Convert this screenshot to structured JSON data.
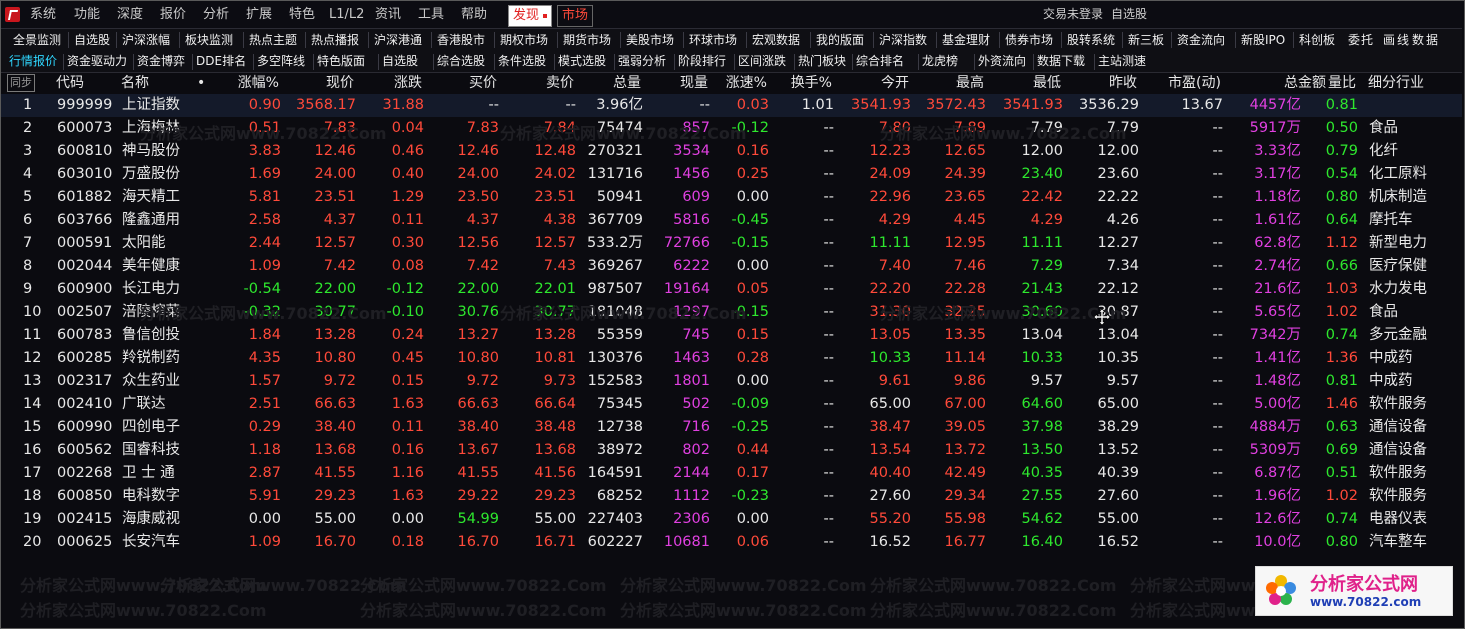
{
  "titlebar": {
    "menu": [
      "系统",
      "功能",
      "深度",
      "报价",
      "分析",
      "扩展",
      "特色",
      "L1/L2",
      "资讯",
      "工具",
      "帮助"
    ],
    "discover_tab": "发现",
    "market_tab": "市场",
    "status_login": "交易未登录",
    "status_watch": "自选股"
  },
  "nav_row1": [
    "全景监测",
    "自选股",
    "沪深涨幅",
    "板块监测",
    "热点主题",
    "热点播报",
    "沪深港通",
    "香港股市",
    "期权市场",
    "期货市场",
    "美股市场",
    "环球市场",
    "宏观数据",
    "我的版面",
    "沪深指数",
    "基金理财",
    "债券市场",
    "股转系统",
    "新三板",
    "资金流向",
    "新股IPO",
    "科创板",
    "委",
    "托",
    "画",
    "线",
    "数",
    "据"
  ],
  "nav_row2": [
    "行情报价",
    "资金驱动力",
    "资金博弈",
    "DDE排名",
    "多空阵线",
    "特色版面",
    "自选股",
    "综合选股",
    "条件选股",
    "模式选股",
    "强弱分析",
    "阶段排行",
    "区间涨跌",
    "热门板块",
    "综合排名",
    "龙虎榜",
    "外资流向",
    "数据下载",
    "主站测速"
  ],
  "table": {
    "sync_label": "同步",
    "headers": [
      "代码",
      "名称",
      "•",
      "涨幅%",
      "现价",
      "涨跌",
      "买价",
      "卖价",
      "总量",
      "现量",
      "涨速%",
      "换手%",
      "今开",
      "最高",
      "最低",
      "昨收",
      "市盈(动)",
      "总金额",
      "量比",
      "细分行业"
    ],
    "rows": [
      {
        "idx": "1",
        "code": "999999",
        "name": "上证指数",
        "chg_pct": "0.90",
        "price": "3568.17",
        "chg": "31.88",
        "bid": "--",
        "ask": "--",
        "vol": "3.96亿",
        "cur_vol": "--",
        "speed": "0.03",
        "turnover": "1.01",
        "open": "3541.93",
        "high": "3572.43",
        "low": "3541.93",
        "prev": "3536.29",
        "pe": "13.67",
        "amount": "4457亿",
        "ratio": "0.81",
        "industry": ""
      },
      {
        "idx": "2",
        "code": "600073",
        "name": "上海梅林",
        "chg_pct": "0.51",
        "price": "7.83",
        "chg": "0.04",
        "bid": "7.83",
        "ask": "7.84",
        "vol": "75474",
        "cur_vol": "857",
        "speed": "-0.12",
        "turnover": "--",
        "open": "7.80",
        "high": "7.89",
        "low": "7.79",
        "prev": "7.79",
        "pe": "--",
        "amount": "5917万",
        "ratio": "0.50",
        "industry": "食品"
      },
      {
        "idx": "3",
        "code": "600810",
        "name": "神马股份",
        "chg_pct": "3.83",
        "price": "12.46",
        "chg": "0.46",
        "bid": "12.46",
        "ask": "12.48",
        "vol": "270321",
        "cur_vol": "3534",
        "speed": "0.16",
        "turnover": "--",
        "open": "12.23",
        "high": "12.65",
        "low": "12.00",
        "prev": "12.00",
        "pe": "--",
        "amount": "3.33亿",
        "ratio": "0.79",
        "industry": "化纤"
      },
      {
        "idx": "4",
        "code": "603010",
        "name": "万盛股份",
        "chg_pct": "1.69",
        "price": "24.00",
        "chg": "0.40",
        "bid": "24.00",
        "ask": "24.02",
        "vol": "131716",
        "cur_vol": "1456",
        "speed": "0.25",
        "turnover": "--",
        "open": "24.09",
        "high": "24.39",
        "low": "23.40",
        "prev": "23.60",
        "pe": "--",
        "amount": "3.17亿",
        "ratio": "0.54",
        "industry": "化工原料"
      },
      {
        "idx": "5",
        "code": "601882",
        "name": "海天精工",
        "chg_pct": "5.81",
        "price": "23.51",
        "chg": "1.29",
        "bid": "23.50",
        "ask": "23.51",
        "vol": "50941",
        "cur_vol": "609",
        "speed": "0.00",
        "turnover": "--",
        "open": "22.96",
        "high": "23.65",
        "low": "22.42",
        "prev": "22.22",
        "pe": "--",
        "amount": "1.18亿",
        "ratio": "0.80",
        "industry": "机床制造"
      },
      {
        "idx": "6",
        "code": "603766",
        "name": "隆鑫通用",
        "chg_pct": "2.58",
        "price": "4.37",
        "chg": "0.11",
        "bid": "4.37",
        "ask": "4.38",
        "vol": "367709",
        "cur_vol": "5816",
        "speed": "-0.45",
        "turnover": "--",
        "open": "4.29",
        "high": "4.45",
        "low": "4.29",
        "prev": "4.26",
        "pe": "--",
        "amount": "1.61亿",
        "ratio": "0.64",
        "industry": "摩托车"
      },
      {
        "idx": "7",
        "code": "000591",
        "name": "太阳能",
        "chg_pct": "2.44",
        "price": "12.57",
        "chg": "0.30",
        "bid": "12.56",
        "ask": "12.57",
        "vol": "533.2万",
        "cur_vol": "72766",
        "speed": "-0.15",
        "turnover": "--",
        "open": "11.11",
        "high": "12.95",
        "low": "11.11",
        "prev": "12.27",
        "pe": "--",
        "amount": "62.8亿",
        "ratio": "1.12",
        "industry": "新型电力"
      },
      {
        "idx": "8",
        "code": "002044",
        "name": "美年健康",
        "chg_pct": "1.09",
        "price": "7.42",
        "chg": "0.08",
        "bid": "7.42",
        "ask": "7.43",
        "vol": "369267",
        "cur_vol": "6222",
        "speed": "0.00",
        "turnover": "--",
        "open": "7.40",
        "high": "7.46",
        "low": "7.29",
        "prev": "7.34",
        "pe": "--",
        "amount": "2.74亿",
        "ratio": "0.66",
        "industry": "医疗保健"
      },
      {
        "idx": "9",
        "code": "600900",
        "name": "长江电力",
        "chg_pct": "-0.54",
        "price": "22.00",
        "chg": "-0.12",
        "bid": "22.00",
        "ask": "22.01",
        "vol": "987507",
        "cur_vol": "19164",
        "speed": "0.05",
        "turnover": "--",
        "open": "22.20",
        "high": "22.28",
        "low": "21.43",
        "prev": "22.12",
        "pe": "--",
        "amount": "21.6亿",
        "ratio": "1.03",
        "industry": "水力发电"
      },
      {
        "idx": "10",
        "code": "002507",
        "name": "涪陵榨菜",
        "chg_pct": "-0.32",
        "price": "30.77",
        "chg": "-0.10",
        "bid": "30.76",
        "ask": "30.77",
        "vol": "181048",
        "cur_vol": "1297",
        "speed": "-0.15",
        "turnover": "--",
        "open": "31.30",
        "high": "32.25",
        "low": "30.60",
        "prev": "30.87",
        "pe": "--",
        "amount": "5.65亿",
        "ratio": "1.02",
        "industry": "食品"
      },
      {
        "idx": "11",
        "code": "600783",
        "name": "鲁信创投",
        "chg_pct": "1.84",
        "price": "13.28",
        "chg": "0.24",
        "bid": "13.27",
        "ask": "13.28",
        "vol": "55359",
        "cur_vol": "745",
        "speed": "0.15",
        "turnover": "--",
        "open": "13.05",
        "high": "13.35",
        "low": "13.04",
        "prev": "13.04",
        "pe": "--",
        "amount": "7342万",
        "ratio": "0.74",
        "industry": "多元金融"
      },
      {
        "idx": "12",
        "code": "600285",
        "name": "羚锐制药",
        "chg_pct": "4.35",
        "price": "10.80",
        "chg": "0.45",
        "bid": "10.80",
        "ask": "10.81",
        "vol": "130376",
        "cur_vol": "1463",
        "speed": "0.28",
        "turnover": "--",
        "open": "10.33",
        "high": "11.14",
        "low": "10.33",
        "prev": "10.35",
        "pe": "--",
        "amount": "1.41亿",
        "ratio": "1.36",
        "industry": "中成药"
      },
      {
        "idx": "13",
        "code": "002317",
        "name": "众生药业",
        "chg_pct": "1.57",
        "price": "9.72",
        "chg": "0.15",
        "bid": "9.72",
        "ask": "9.73",
        "vol": "152583",
        "cur_vol": "1801",
        "speed": "0.00",
        "turnover": "--",
        "open": "9.61",
        "high": "9.86",
        "low": "9.57",
        "prev": "9.57",
        "pe": "--",
        "amount": "1.48亿",
        "ratio": "0.81",
        "industry": "中成药"
      },
      {
        "idx": "14",
        "code": "002410",
        "name": "广联达",
        "chg_pct": "2.51",
        "price": "66.63",
        "chg": "1.63",
        "bid": "66.63",
        "ask": "66.64",
        "vol": "75345",
        "cur_vol": "502",
        "speed": "-0.09",
        "turnover": "--",
        "open": "65.00",
        "high": "67.00",
        "low": "64.60",
        "prev": "65.00",
        "pe": "--",
        "amount": "5.00亿",
        "ratio": "1.46",
        "industry": "软件服务"
      },
      {
        "idx": "15",
        "code": "600990",
        "name": "四创电子",
        "chg_pct": "0.29",
        "price": "38.40",
        "chg": "0.11",
        "bid": "38.40",
        "ask": "38.48",
        "vol": "12738",
        "cur_vol": "716",
        "speed": "-0.25",
        "turnover": "--",
        "open": "38.47",
        "high": "39.05",
        "low": "37.98",
        "prev": "38.29",
        "pe": "--",
        "amount": "4884万",
        "ratio": "0.63",
        "industry": "通信设备"
      },
      {
        "idx": "16",
        "code": "600562",
        "name": "国睿科技",
        "chg_pct": "1.18",
        "price": "13.68",
        "chg": "0.16",
        "bid": "13.67",
        "ask": "13.68",
        "vol": "38972",
        "cur_vol": "802",
        "speed": "0.44",
        "turnover": "--",
        "open": "13.54",
        "high": "13.72",
        "low": "13.50",
        "prev": "13.52",
        "pe": "--",
        "amount": "5309万",
        "ratio": "0.69",
        "industry": "通信设备"
      },
      {
        "idx": "17",
        "code": "002268",
        "name": "卫 士 通",
        "chg_pct": "2.87",
        "price": "41.55",
        "chg": "1.16",
        "bid": "41.55",
        "ask": "41.56",
        "vol": "164591",
        "cur_vol": "2144",
        "speed": "0.17",
        "turnover": "--",
        "open": "40.40",
        "high": "42.49",
        "low": "40.35",
        "prev": "40.39",
        "pe": "--",
        "amount": "6.87亿",
        "ratio": "0.51",
        "industry": "软件服务"
      },
      {
        "idx": "18",
        "code": "600850",
        "name": "电科数字",
        "chg_pct": "5.91",
        "price": "29.23",
        "chg": "1.63",
        "bid": "29.22",
        "ask": "29.23",
        "vol": "68252",
        "cur_vol": "1112",
        "speed": "-0.23",
        "turnover": "--",
        "open": "27.60",
        "high": "29.34",
        "low": "27.55",
        "prev": "27.60",
        "pe": "--",
        "amount": "1.96亿",
        "ratio": "1.02",
        "industry": "软件服务"
      },
      {
        "idx": "19",
        "code": "002415",
        "name": "海康威视",
        "chg_pct": "0.00",
        "price": "55.00",
        "chg": "0.00",
        "bid": "54.99",
        "ask": "55.00",
        "vol": "227403",
        "cur_vol": "2306",
        "speed": "0.00",
        "turnover": "--",
        "open": "55.20",
        "high": "55.98",
        "low": "54.62",
        "prev": "55.00",
        "pe": "--",
        "amount": "12.6亿",
        "ratio": "0.74",
        "industry": "电器仪表"
      },
      {
        "idx": "20",
        "code": "000625",
        "name": "长安汽车",
        "chg_pct": "1.09",
        "price": "16.70",
        "chg": "0.18",
        "bid": "16.70",
        "ask": "16.71",
        "vol": "602227",
        "cur_vol": "10681",
        "speed": "0.06",
        "turnover": "--",
        "open": "16.52",
        "high": "16.77",
        "low": "16.40",
        "prev": "16.52",
        "pe": "--",
        "amount": "10.0亿",
        "ratio": "0.80",
        "industry": "汽车整车"
      }
    ]
  },
  "watermark": {
    "brand": "分析家公式网",
    "url": "www.70822.com",
    "repeat_text": "分析家公式网www.70822.Com"
  },
  "colors": {
    "up": "#ff4a3a",
    "down": "#2ee82e",
    "neutral": "#e8e8e8",
    "volume": "#e040e0",
    "active_tab": "#2fd7ff"
  }
}
